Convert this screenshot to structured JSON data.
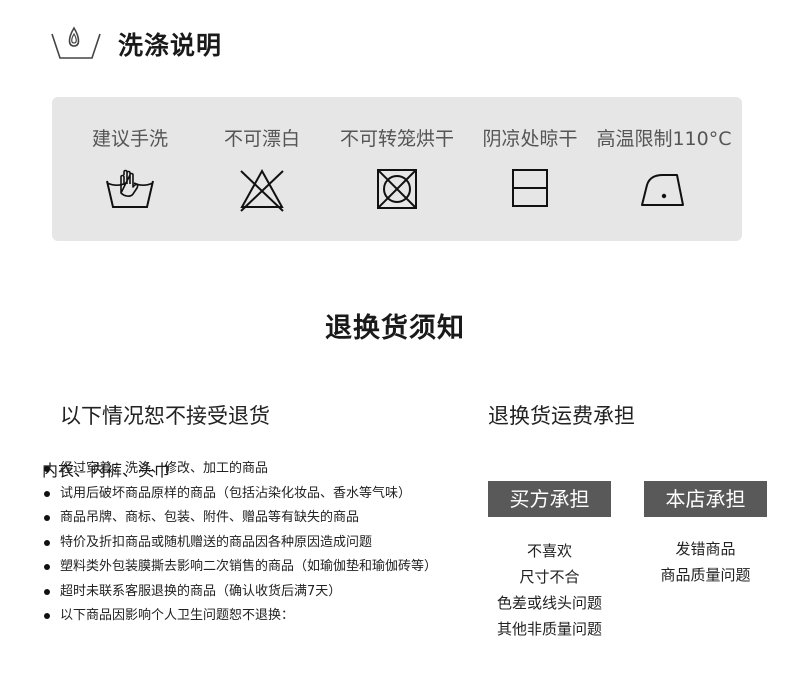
{
  "washing": {
    "title": "洗涤说明",
    "items": [
      {
        "label": "建议手洗",
        "icon": "hand-wash-icon"
      },
      {
        "label": "不可漂白",
        "icon": "no-bleach-icon"
      },
      {
        "label": "不可转笼烘干",
        "icon": "no-tumble-dry-icon"
      },
      {
        "label": "阴凉处晾干",
        "icon": "dry-in-shade-icon"
      },
      {
        "label": "高温限制110°C",
        "icon": "iron-low-temp-icon"
      }
    ]
  },
  "exchange": {
    "title": "退换货须知",
    "no_return": {
      "title": "以下情况恕不接受退货",
      "items": [
        "经过穿着、洗涤、修改、加工的商品",
        "试用后破坏商品原样的商品（包括沾染化妆品、香水等气味）",
        "商品吊牌、商标、包装、附件、赠品等有缺失的商品",
        "特价及折扣商品或随机赠送的商品因各种原因造成问题",
        "塑料类外包装膜撕去影响二次销售的商品（如瑜伽垫和瑜伽砖等）",
        "超时未联系客服退换的商品（确认收货后满7天）",
        "以下商品因影响个人卫生问题恕不退换："
      ],
      "continuation": "内衣、内裤、头巾"
    },
    "shipping": {
      "title": "退换货运费承担",
      "buyer": {
        "label": "买方承担",
        "items": [
          "不喜欢",
          "尺寸不合",
          "色差或线头问题",
          "其他非质量问题"
        ]
      },
      "store": {
        "label": "本店承担",
        "items": [
          "发错商品",
          "商品质量问题"
        ]
      }
    }
  }
}
